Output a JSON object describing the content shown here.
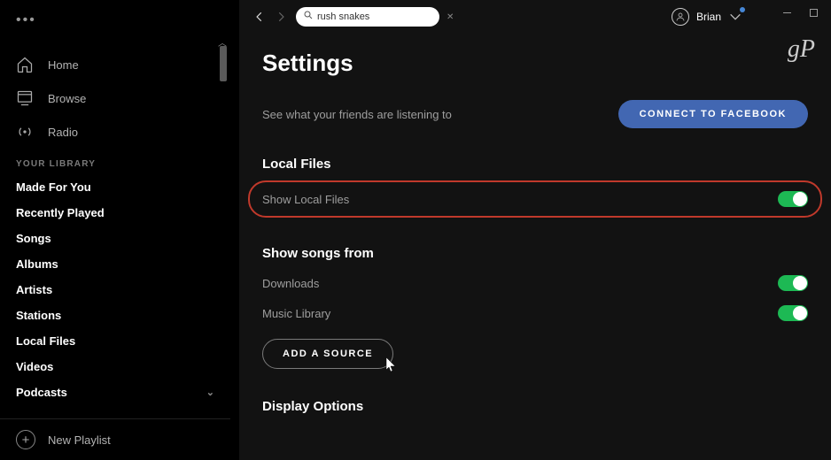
{
  "topbar": {
    "search_value": "rush snakes",
    "user_name": "Brian"
  },
  "sidebar": {
    "nav": [
      {
        "label": "Home"
      },
      {
        "label": "Browse"
      },
      {
        "label": "Radio"
      }
    ],
    "library_heading": "YOUR LIBRARY",
    "library": [
      "Made For You",
      "Recently Played",
      "Songs",
      "Albums",
      "Artists",
      "Stations",
      "Local Files",
      "Videos",
      "Podcasts"
    ],
    "new_playlist": "New Playlist"
  },
  "main": {
    "title": "Settings",
    "friends_text": "See what your friends are listening to",
    "facebook_button": "CONNECT TO FACEBOOK",
    "local_files_heading": "Local Files",
    "show_local_files": "Show Local Files",
    "show_songs_heading": "Show songs from",
    "sources": [
      "Downloads",
      "Music Library"
    ],
    "add_source": "ADD A SOURCE",
    "display_options_heading": "Display Options"
  },
  "watermark": "gP"
}
